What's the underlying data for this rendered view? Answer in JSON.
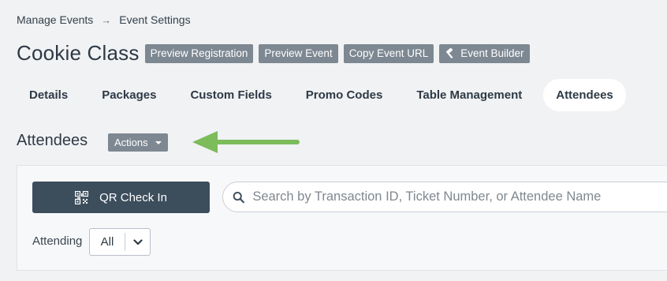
{
  "breadcrumb": {
    "items": [
      "Manage Events",
      "Event Settings"
    ],
    "separator": "→"
  },
  "header": {
    "title": "Cookie Class",
    "buttons": [
      "Preview Registration",
      "Preview Event",
      "Copy Event URL",
      "Event Builder"
    ],
    "builder_icon": "hammer-icon"
  },
  "tabs": [
    {
      "label": "Details",
      "active": false
    },
    {
      "label": "Packages",
      "active": false
    },
    {
      "label": "Custom Fields",
      "active": false
    },
    {
      "label": "Promo Codes",
      "active": false
    },
    {
      "label": "Table Management",
      "active": false
    },
    {
      "label": "Attendees",
      "active": true
    }
  ],
  "section": {
    "title": "Attendees",
    "actions_label": "Actions"
  },
  "panel": {
    "qr_button_label": "QR Check In",
    "qr_icon": "qr-code-icon",
    "search_placeholder": "Search by Transaction ID, Ticket Number, or Attendee Name",
    "search_value": "",
    "attending_label": "Attending",
    "attending_selected": "All"
  },
  "colors": {
    "background": "#f1f2f4",
    "header_button": "#7d8892",
    "primary_button": "#3c4d5c",
    "annotation_arrow": "#7cbc5a"
  }
}
